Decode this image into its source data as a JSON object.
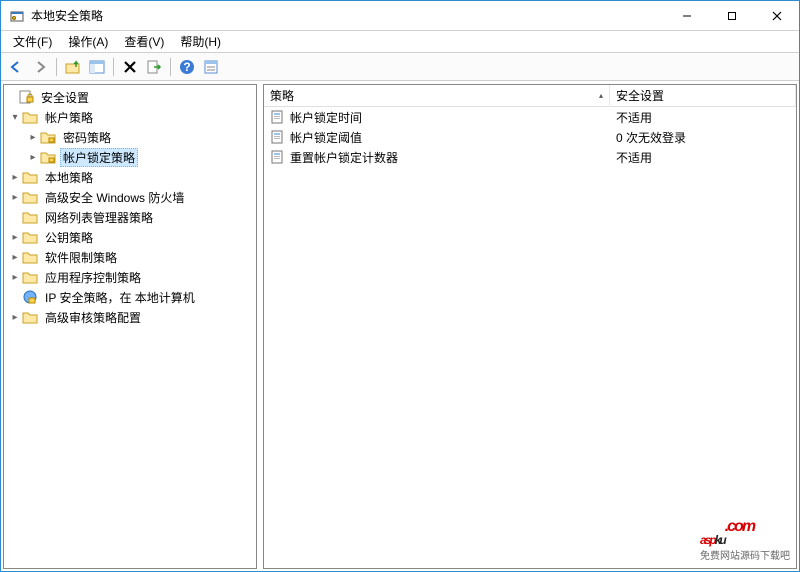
{
  "window": {
    "title": "本地安全策略"
  },
  "menu": {
    "file": "文件(F)",
    "action": "操作(A)",
    "view": "查看(V)",
    "help": "帮助(H)"
  },
  "tree": {
    "root": "安全设置",
    "account_policy": "帐户策略",
    "password_policy": "密码策略",
    "lockout_policy": "帐户锁定策略",
    "local_policy": "本地策略",
    "firewall": "高级安全 Windows 防火墙",
    "network_list": "网络列表管理器策略",
    "public_key": "公钥策略",
    "software_restriction": "软件限制策略",
    "app_control": "应用程序控制策略",
    "ip_security": "IP 安全策略，在 本地计算机",
    "audit": "高级审核策略配置"
  },
  "list": {
    "header_policy": "策略",
    "header_setting": "安全设置",
    "rows": {
      "r0_policy": "帐户锁定时间",
      "r0_setting": "不适用",
      "r1_policy": "帐户锁定阈值",
      "r1_setting": "0 次无效登录",
      "r2_policy": "重置帐户锁定计数器",
      "r2_setting": "不适用"
    }
  },
  "watermark": {
    "brand1": "asp",
    "brand2": "ku",
    "dotcom": ".com",
    "sub": "免费网站源码下载吧"
  }
}
